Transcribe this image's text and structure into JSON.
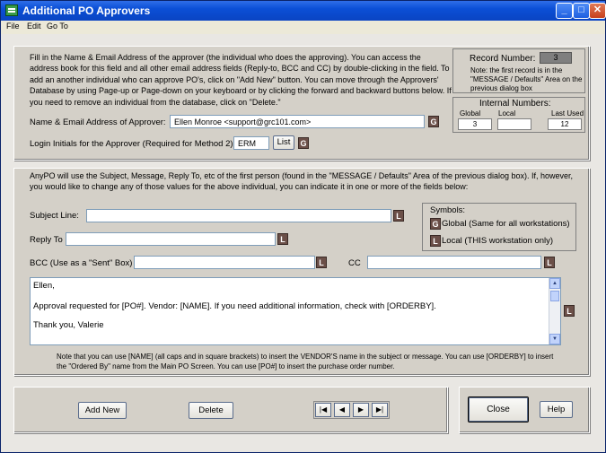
{
  "window": {
    "title": "Additional PO Approvers"
  },
  "menu": [
    "File",
    "Edit",
    "Go To"
  ],
  "intro_text": "Fill in the Name & Email Address of the approver (the individual who does the approving). You can access the address book for this field and all other email address fields (Reply-to, BCC and CC) by double-clicking in the field. To add an another individual who can approve PO's, click on \"Add New\" button. You can move through the Approvers' Database by using Page-up or Page-down on your keyboard or by clicking the forward and backward buttons below. If you need to remove an individual from the database, click on \"Delete.\"",
  "record": {
    "label": "Record Number:",
    "value": "3",
    "note": "Note: the first record is in the \"MESSAGE / Defaults\" Area on the previous dialog box"
  },
  "internal": {
    "title": "Internal Numbers:",
    "global_label": "Global",
    "global_value": "3",
    "local_label": "Local",
    "local_value": "",
    "last_used_label": "Last Used",
    "last_used_value": "12"
  },
  "approver": {
    "label": "Name & Email Address of Approver:",
    "value": "Ellen Monroe <support@grc101.com>"
  },
  "login": {
    "label": "Login Initials for the Approver (Required for Method 2):",
    "value": "ERM",
    "list_button": "List"
  },
  "badges": {
    "global": "G",
    "local": "L"
  },
  "anypo_text": "AnyPO will use the Subject, Message, Reply To, etc of the first person (found in the \"MESSAGE / Defaults\" Area of the previous dialog box). If, however, you would like to change any of those values for the above individual, you can indicate it in one or more of the fields below:",
  "subject": {
    "label": "Subject Line:",
    "value": ""
  },
  "reply_to": {
    "label": "Reply To",
    "value": ""
  },
  "bcc": {
    "label": "BCC (Use as a \"Sent\" Box)",
    "value": ""
  },
  "cc": {
    "label": "CC",
    "value": ""
  },
  "symbols": {
    "title": "Symbols:",
    "global_text": "Global (Same for all workstations)",
    "local_text": "Local (THIS workstation only)"
  },
  "message": {
    "line1": "Ellen,",
    "line2": "Approval requested for [PO#].  Vendor: [NAME].  If you need additional information, check with [ORDERBY].",
    "line3": "Thank you, Valerie"
  },
  "note_text": "Note that you can use [NAME] (all caps and in square brackets) to insert the VENDOR'S name in the subject or message.  You can use [ORDERBY] to insert the \"Ordered By\" name from the Main PO Screen.  You can use [PO#] to insert the purchase order number.",
  "buttons": {
    "add_new": "Add New",
    "delete": "Delete",
    "close": "Close",
    "help": "Help"
  },
  "nav": {
    "first": "|◀",
    "prev": "◀",
    "next": "▶",
    "last": "▶|"
  }
}
